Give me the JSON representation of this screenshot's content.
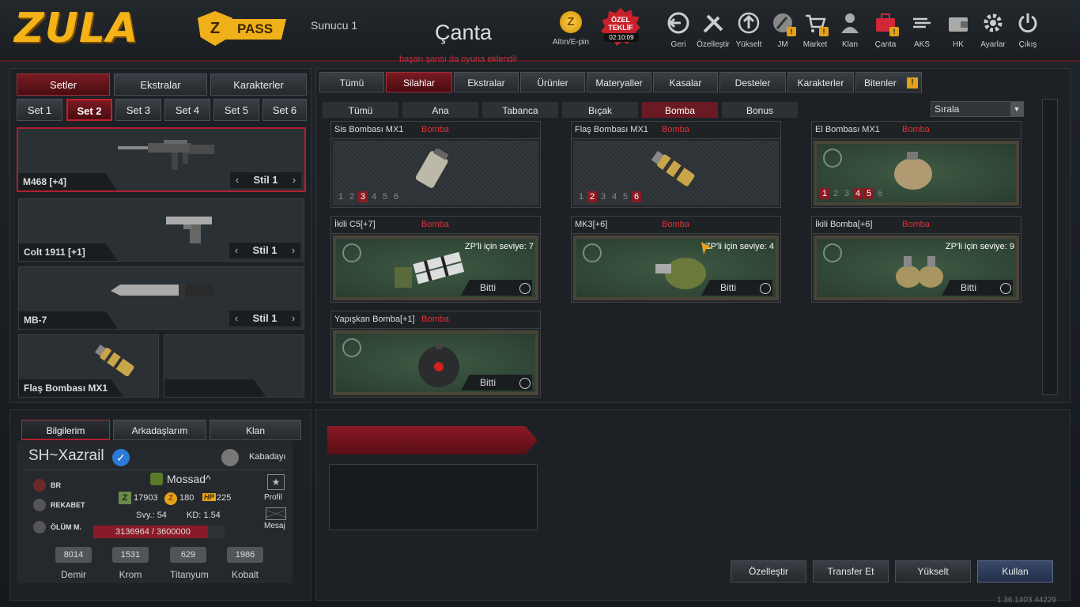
{
  "header": {
    "logo_text": "ZULA",
    "pass_letter": "Z",
    "pass_label": "PASS",
    "server": "Sunucu 1",
    "title": "Çanta",
    "ticker": "başarı şansı da oyuna eklendi!",
    "gold_letter": "Z",
    "gold_label": "Altın/E-pin",
    "offer_line1": "ÖZEL",
    "offer_line2": "TEKLİF",
    "offer_timer": "02:10:09",
    "nav": [
      {
        "label": "Geri",
        "icon": "back-icon",
        "warn": false
      },
      {
        "label": "Özelleştir",
        "icon": "tools-icon",
        "warn": false
      },
      {
        "label": "Yükselt",
        "icon": "upgrade-icon",
        "warn": false
      },
      {
        "label": "JM",
        "icon": "jm-icon",
        "warn": true
      },
      {
        "label": "Market",
        "icon": "cart-icon",
        "warn": true
      },
      {
        "label": "Klan",
        "icon": "clan-icon",
        "warn": false
      },
      {
        "label": "Çanta",
        "icon": "bag-icon",
        "warn": true
      },
      {
        "label": "AKS",
        "icon": "aks-icon",
        "warn": false
      },
      {
        "label": "HK",
        "icon": "wallet-icon",
        "warn": false
      },
      {
        "label": "Ayarlar",
        "icon": "gear-icon",
        "warn": false
      },
      {
        "label": "Çıkış",
        "icon": "power-icon",
        "warn": false
      }
    ],
    "warn_mark": "!"
  },
  "left": {
    "tabs": [
      "Setler",
      "Ekstralar",
      "Karakterler"
    ],
    "sets": [
      "Set 1",
      "Set 2",
      "Set 3",
      "Set 4",
      "Set 5",
      "Set 6"
    ],
    "weapons": [
      {
        "name": "M468 [+4]",
        "stil": "Stil 1"
      },
      {
        "name": "Colt 1911 [+1]",
        "stil": "Stil 1"
      },
      {
        "name": "MB-7",
        "stil": "Stil 1"
      },
      {
        "name": "Flaş Bombası MX1"
      }
    ],
    "arrow_left": "‹",
    "arrow_right": "›"
  },
  "right": {
    "categories": [
      "Tümü",
      "Silahlar",
      "Ekstralar",
      "Ürünler",
      "Materyaller",
      "Kasalar",
      "Desteler",
      "Karakterler",
      "Bitenler"
    ],
    "subcategories": [
      "Tümü",
      "Ana",
      "Tabanca",
      "Bıçak",
      "Bomba",
      "Bonus"
    ],
    "sort_label": "Sırala",
    "sort_arrow": "▼",
    "items": [
      {
        "name": "Sis Bombası MX1",
        "type": "Bomba",
        "levels": [
          "1",
          "2",
          "3",
          "4",
          "5",
          "6"
        ],
        "active_level": 3
      },
      {
        "name": "Flaş Bombası MX1",
        "type": "Bomba",
        "levels": [
          "1",
          "2",
          "3",
          "4",
          "5",
          "6"
        ],
        "active_levels": [
          2,
          6
        ]
      },
      {
        "name": "El Bombası MX1",
        "type": "Bomba",
        "levels": [
          "1",
          "2",
          "3",
          "4",
          "5",
          "6"
        ],
        "active_levels": [
          1,
          4,
          5
        ]
      },
      {
        "name": "İkili C5[+7]",
        "type": "Bomba",
        "zp": "ZP'li için seviye: 7",
        "status": "Bitti"
      },
      {
        "name": "MK3[+6]",
        "type": "Bomba",
        "zp": "ZP'li için seviye: 4",
        "status": "Bitti"
      },
      {
        "name": "İkili Bomba[+6]",
        "type": "Bomba",
        "zp": "ZP'li için seviye: 9",
        "status": "Bitti"
      },
      {
        "name": "Yapışkan Bomba[+1]",
        "type": "Bomba",
        "status": "Bitti"
      }
    ]
  },
  "profile": {
    "tabs": [
      "Bilgilerim",
      "Arkadaşlarım",
      "Klan"
    ],
    "username": "SH~Xazrail",
    "rank_title": "Kabadayı",
    "clan_name": "Mossad^",
    "badges": [
      "BR",
      "REKABET",
      "ÖLÜM M."
    ],
    "zp": "17903",
    "gold": "180",
    "hp_label": "HP",
    "hp": "225",
    "level_text": "Svy.: 54",
    "kd_text": "KD: 1.54",
    "xp_text": "3136964 / 3600000",
    "xp_progress": 0.871,
    "profile_label": "Profil",
    "message_label": "Mesaj",
    "resources": [
      {
        "value": "8014",
        "label": "Demir"
      },
      {
        "value": "1531",
        "label": "Krom"
      },
      {
        "value": "629",
        "label": "Titanyum"
      },
      {
        "value": "1986",
        "label": "Kobalt"
      }
    ]
  },
  "actions": [
    "Özelleştir",
    "Transfer Et",
    "Yükselt",
    "Kullan"
  ],
  "version": "1.36.1403.44229"
}
